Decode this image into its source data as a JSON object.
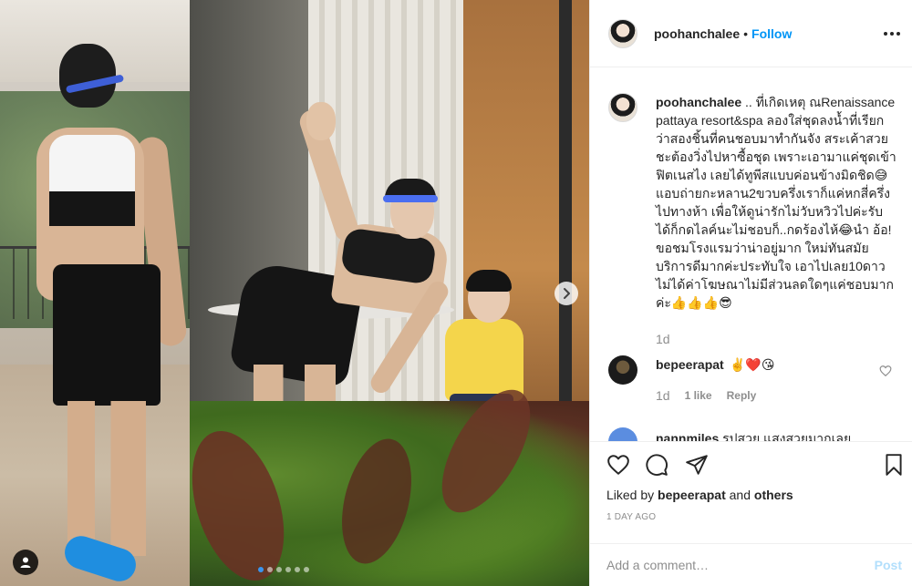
{
  "header": {
    "username": "poohanchalee",
    "separator": "•",
    "follow_label": "Follow"
  },
  "caption": {
    "username": "poohanchalee",
    "text": " .. ที่เกิดเหตุ ณRenaissance pattaya resort&spa ลองใส่ชุดลงน้ำที่เรียกว่าสองชิ้นที่คนชอบมาทำกันจัง สระเค้าสวยชะต้องวิ่งไปหาซื้อชุด เพราะเอามาแค่ชุดเข้าฟิตเนสไง เลยได้ทูพีสแบบค่อนข้างมิดชิด😅แอบถ่ายกะหลาน2ขวบครึ่งเราก็แค่หกสี่ครึ่งไปทางห้า เพื่อให้ดูน่ารักไม่วับหวิวไปค่ะรับได้ก็กดไลค์นะไม่ชอบก็..กดร้องไห้😂นำ อ้อ! ขอชมโรงแรมว่าน่าอยู่มาก ใหม่ทันสมัย บริการดีมากค่ะประทับใจ เอาไปเลย10ดาว ไม่ได้ค่าโฆษณาไม่มีส่วนลดใดๆแค่ชอบมากค่ะ👍👍👍😎",
    "time": "1d"
  },
  "comments": [
    {
      "username": "bepeerapat",
      "text": "✌️❤️😘",
      "time": "1d",
      "likes": "1 like",
      "reply_label": "Reply"
    },
    {
      "username": "nannmiles",
      "text": "รูปสวย แสงสวยมากเลย"
    }
  ],
  "actions": {
    "like_icon": "heart-outline-icon",
    "comment_icon": "comment-bubble-icon",
    "share_icon": "paper-plane-icon",
    "save_icon": "bookmark-icon"
  },
  "likes": {
    "prefix": "Liked by",
    "user": "bepeerapat",
    "joiner": "and",
    "others": "others"
  },
  "post_time": "1 DAY AGO",
  "add_comment": {
    "placeholder": "Add a comment…",
    "post_label": "Post"
  },
  "colors": {
    "accent": "#0095f6",
    "post_disabled": "#b2dffc",
    "muted": "#8e8e8e",
    "text": "#262626",
    "carousel_active_dot": "#3a95ef"
  }
}
